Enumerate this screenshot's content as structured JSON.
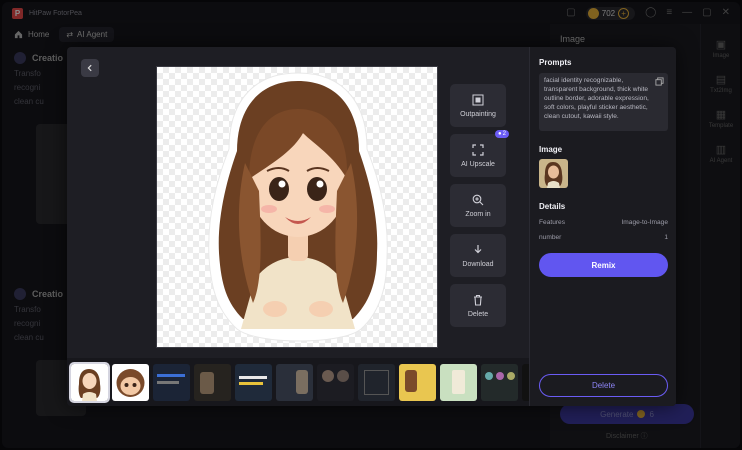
{
  "app": {
    "title": "HitPaw FotorPea",
    "credits": "702"
  },
  "nav": {
    "home_label": "Home",
    "tab_label": "AI Agent"
  },
  "background": {
    "creation_heading_1": "Creatio",
    "creation_heading_2": "Creatio",
    "text_lines_1": [
      "Transfo",
      "recogni",
      "clean cu"
    ],
    "text_lines_2": [
      "Transfo",
      "recogni",
      "clean cu"
    ],
    "right_panel_title": "Image",
    "rail": [
      "Image",
      "Txt2Img",
      "Template",
      "AI Agent"
    ],
    "generate_label": "Generate",
    "generate_cost": "6",
    "disclaimer": "Disclaimer"
  },
  "viewer": {
    "tools": [
      {
        "label": "Outpainting",
        "icon": "outpaint-icon"
      },
      {
        "label": "AI Upscale",
        "icon": "upscale-icon",
        "badge": "2"
      },
      {
        "label": "Zoom in",
        "icon": "zoom-in-icon"
      },
      {
        "label": "Download",
        "icon": "download-icon"
      },
      {
        "label": "Delete",
        "icon": "trash-icon"
      }
    ]
  },
  "details": {
    "prompts_title": "Prompts",
    "prompt_text": "facial identity recognizable, transparent background, thick white outline border, adorable expression, soft colors, playful sticker aesthetic, clean cutout, kawaii style.",
    "image_title": "Image",
    "details_title": "Details",
    "features_label": "Features",
    "features_value": "Image-to-Image",
    "number_label": "number",
    "number_value": "1",
    "remix_label": "Remix",
    "delete_label": "Delete"
  },
  "colors": {
    "accent": "#6156f0",
    "coin": "#e9b23a"
  }
}
